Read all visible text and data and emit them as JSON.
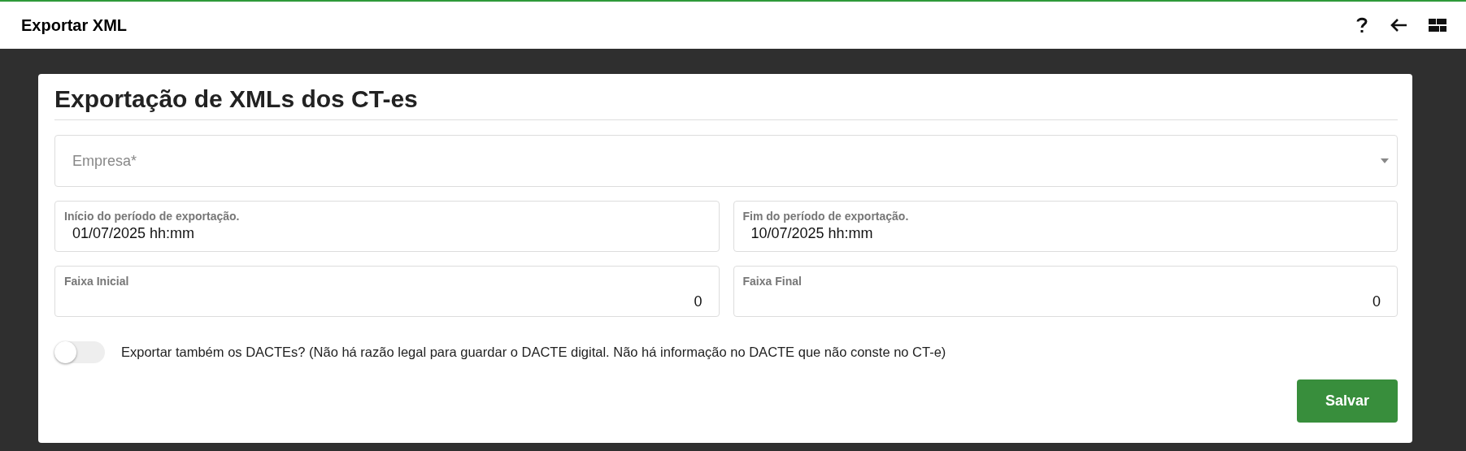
{
  "header": {
    "title": "Exportar XML"
  },
  "card": {
    "title": "Exportação de XMLs dos CT-es",
    "company_select": {
      "placeholder": "Empresa*"
    },
    "date_fields": [
      {
        "label": "Início do período de exportação.",
        "value": "01/07/2025 hh:mm"
      },
      {
        "label": "Fim do período de exportação.",
        "value": "10/07/2025 hh:mm"
      }
    ],
    "range_fields": [
      {
        "label": "Faixa Inicial",
        "value": "0"
      },
      {
        "label": "Faixa Final",
        "value": "0"
      }
    ],
    "toggle": {
      "on": false,
      "label": "Exportar também os DACTEs? (Não há razão legal para guardar o DACTE digital. Não há informação no DACTE que não conste no CT-e)"
    },
    "buttons": [
      "Salvar"
    ]
  }
}
